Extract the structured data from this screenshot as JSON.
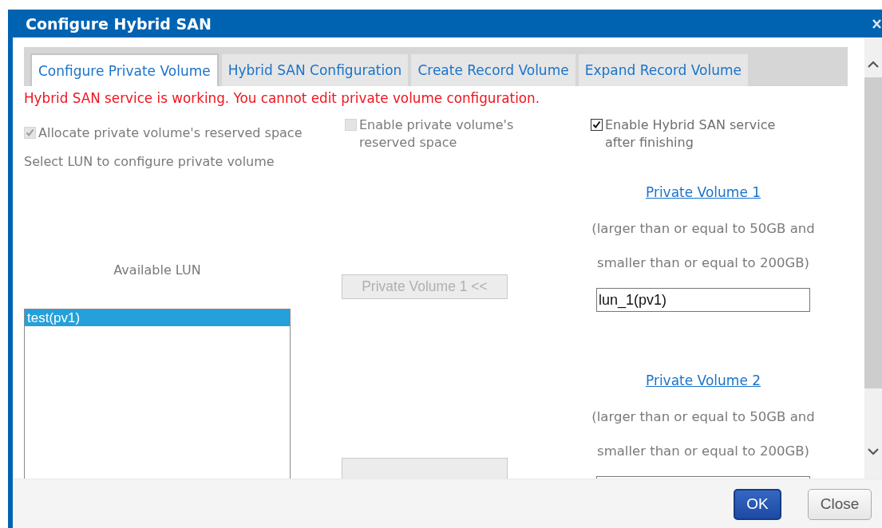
{
  "dialog": {
    "title": "Configure Hybrid SAN"
  },
  "tabs": [
    {
      "label": "Configure Private Volume",
      "selected": true
    },
    {
      "label": "Hybrid SAN Configuration",
      "selected": false
    },
    {
      "label": "Create Record Volume",
      "selected": false
    },
    {
      "label": "Expand Record Volume",
      "selected": false
    }
  ],
  "error_message": "Hybrid SAN service is working. You cannot edit private volume configuration.",
  "options": [
    {
      "label": "Allocate private volume's reserved space",
      "checked": true,
      "disabled": true
    },
    {
      "label": "Enable private volume's reserved space",
      "checked": false,
      "disabled": true
    },
    {
      "label": "Enable Hybrid SAN service after finishing",
      "checked": true,
      "disabled": false
    }
  ],
  "lun_prompt": "Select LUN to configure private volume",
  "available_lun": {
    "heading": "Available LUN",
    "items": [
      {
        "label": "test(pv1)",
        "selected": true
      }
    ]
  },
  "private_volumes": [
    {
      "title": "Private Volume 1",
      "range_line_1": "(larger than or equal to 50GB and",
      "range_line_2": "smaller than or equal to 200GB)",
      "assign_button": "Private Volume 1 <<",
      "assign_disabled": true,
      "value": "lun_1(pv1)"
    },
    {
      "title": "Private Volume 2",
      "range_line_1": "(larger than or equal to 50GB and",
      "range_line_2": "smaller than or equal to 200GB)"
    }
  ],
  "buttons": [
    {
      "label": "OK",
      "kind": "primary"
    },
    {
      "label": "Close",
      "kind": "secondary"
    }
  ]
}
